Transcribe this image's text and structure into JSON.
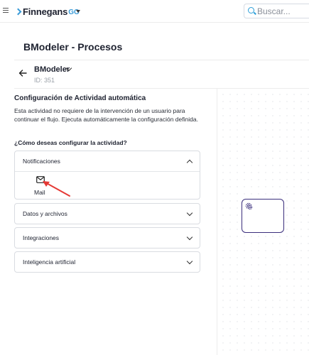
{
  "topbar": {
    "brand_name": "Finnegans",
    "brand_suffix": "GO",
    "search_placeholder": "Buscar..."
  },
  "page": {
    "title": "BModeler - Procesos"
  },
  "process": {
    "name": "BModeler",
    "id_text": "ID: 351"
  },
  "config": {
    "title": "Configuración de Actividad automática",
    "description": "Esta actividad no requiere de la intervención de un usuario para continuar el flujo. Ejecuta automáticamente la configuración definida.",
    "question": "¿Cómo deseas configurar la actividad?"
  },
  "accordions": [
    {
      "label": "Notificaciones",
      "expanded": true,
      "items": [
        {
          "label": "Mail",
          "icon": "mail-icon"
        }
      ]
    },
    {
      "label": "Datos y archivos",
      "expanded": false
    },
    {
      "label": "Integraciones",
      "expanded": false
    },
    {
      "label": "Inteligencia artificial",
      "expanded": false
    }
  ],
  "colors": {
    "brand_accent": "#3a9bd8",
    "node_border": "#3a2e7c",
    "annotation_arrow": "#e53935"
  }
}
